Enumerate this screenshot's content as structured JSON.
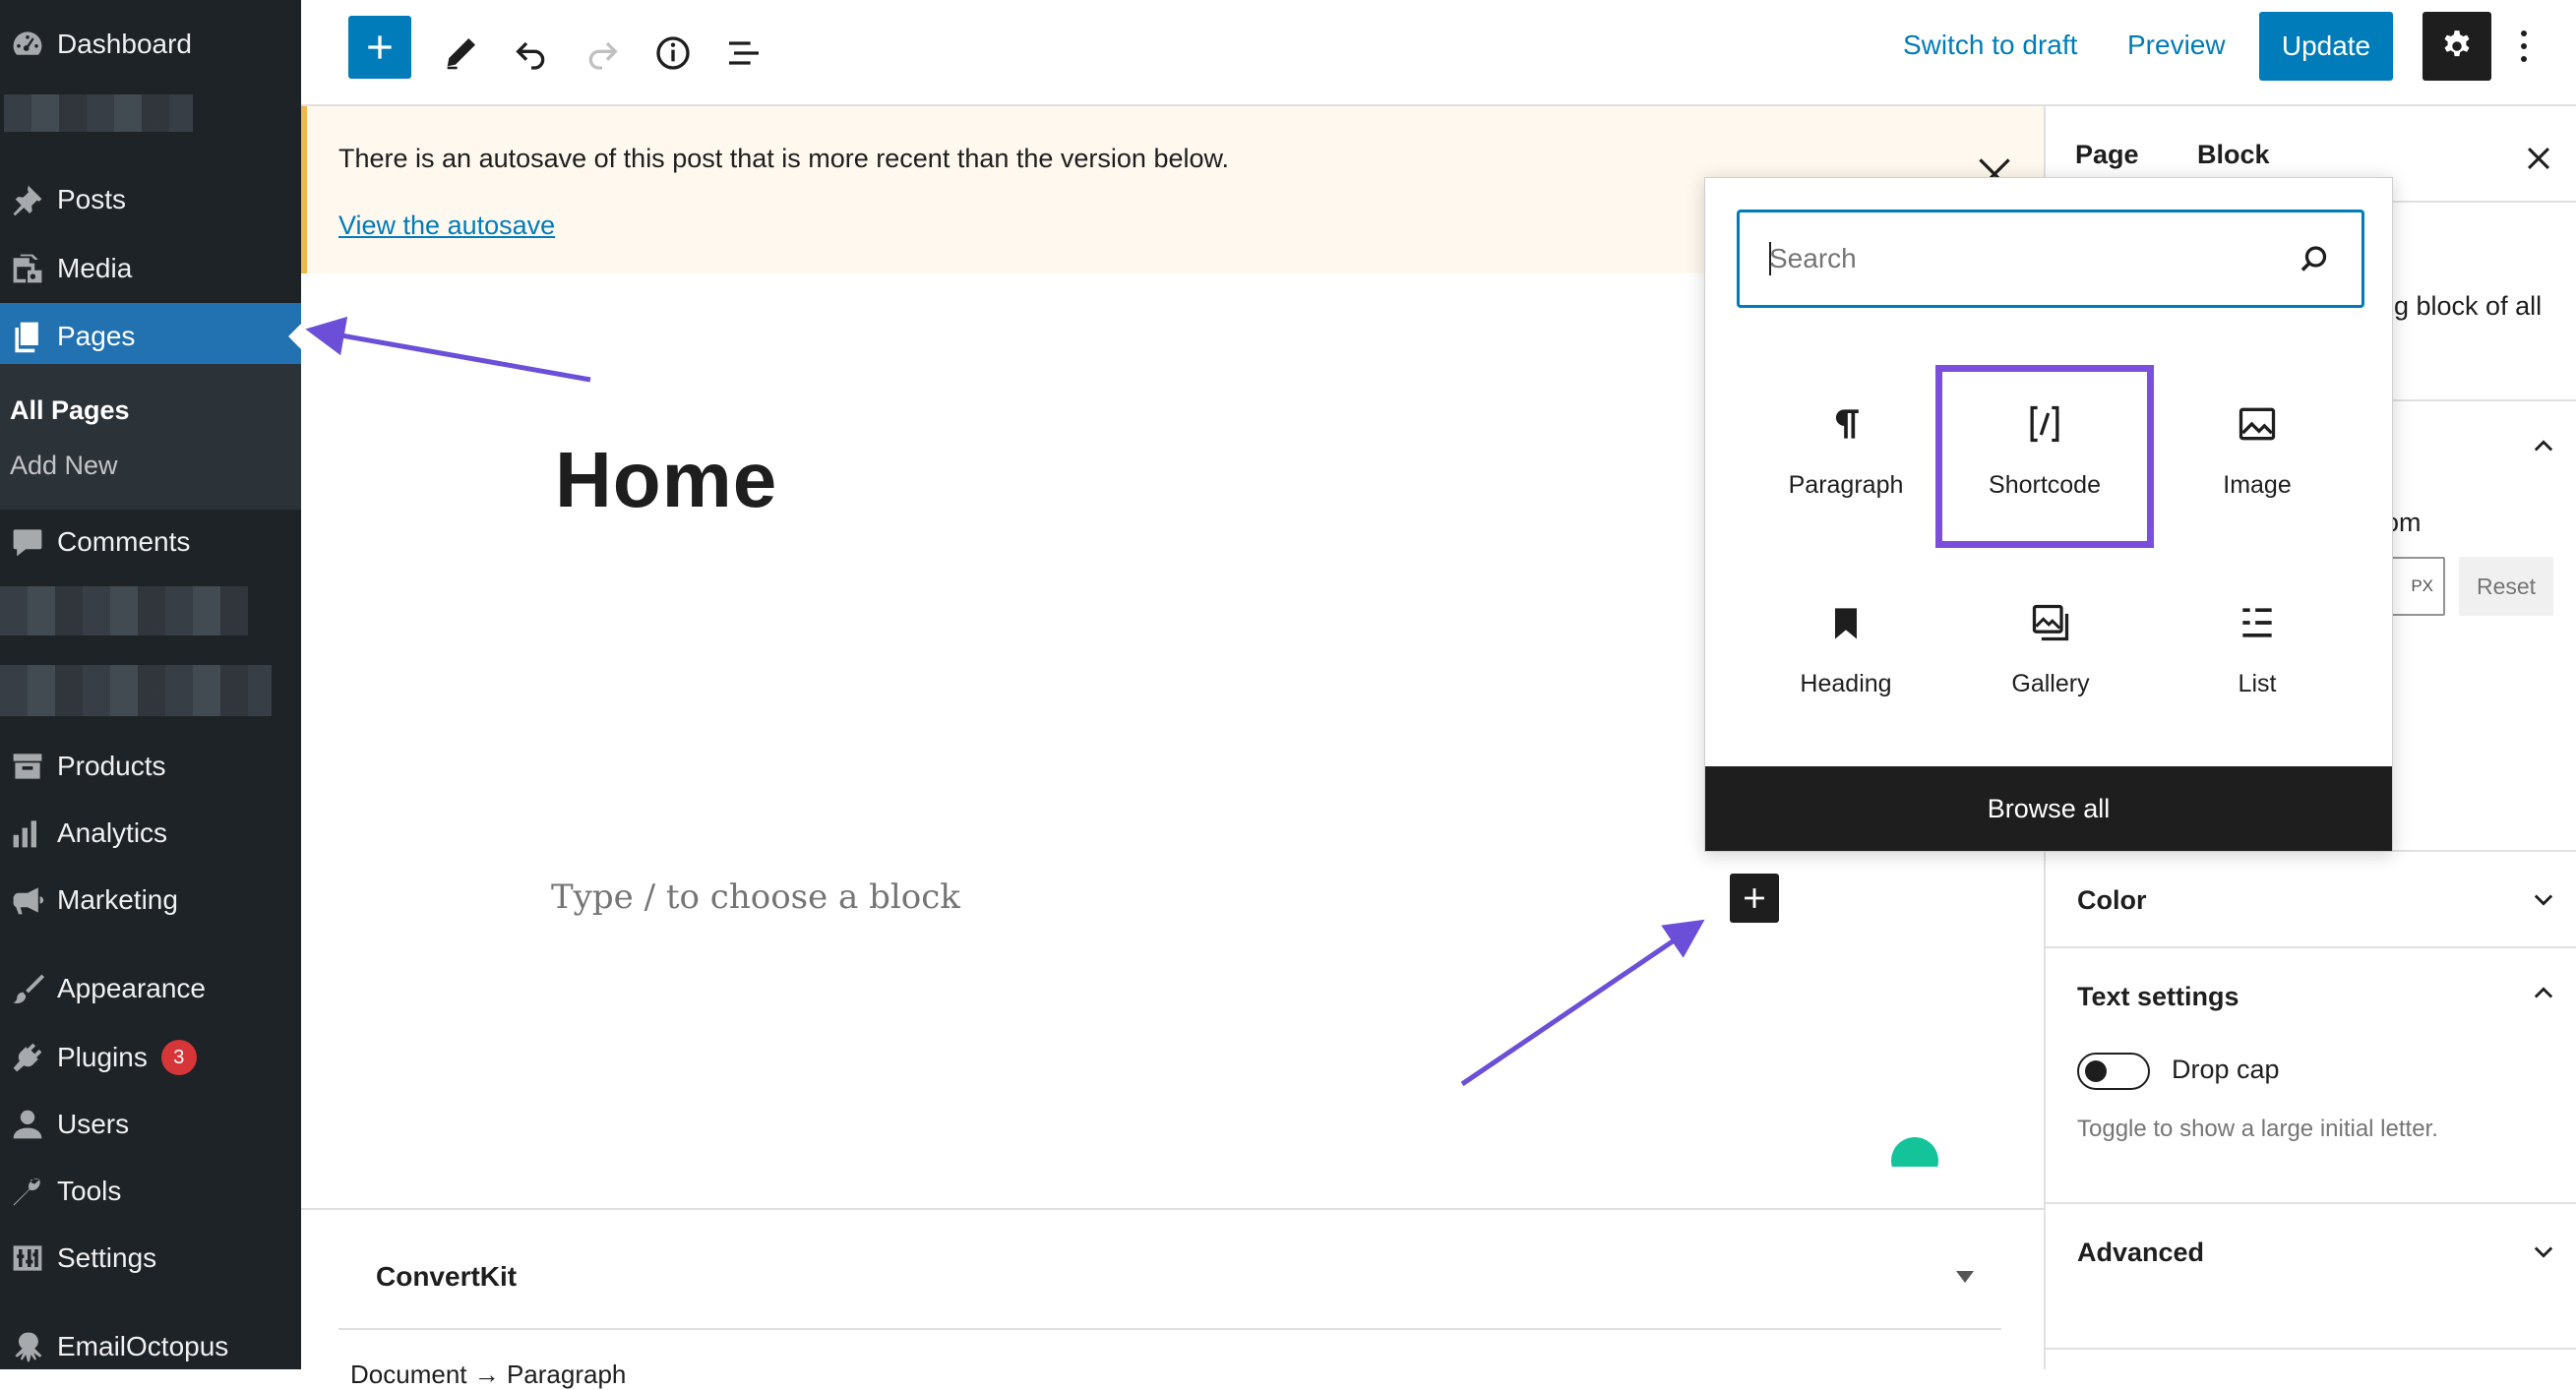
{
  "sidebar": {
    "items": [
      {
        "label": "Dashboard",
        "icon": "dashboard-icon"
      },
      {
        "label": "Posts",
        "icon": "pushpin-icon"
      },
      {
        "label": "Media",
        "icon": "media-icon"
      },
      {
        "label": "Pages",
        "icon": "pages-icon",
        "active": true
      },
      {
        "label": "Comments",
        "icon": "comment-icon"
      },
      {
        "label": "Products",
        "icon": "archive-icon"
      },
      {
        "label": "Analytics",
        "icon": "bar-chart-icon"
      },
      {
        "label": "Marketing",
        "icon": "megaphone-icon"
      },
      {
        "label": "Appearance",
        "icon": "paintbrush-icon"
      },
      {
        "label": "Plugins",
        "icon": "plugin-icon",
        "badge": "3"
      },
      {
        "label": "Users",
        "icon": "user-icon"
      },
      {
        "label": "Tools",
        "icon": "wrench-icon"
      },
      {
        "label": "Settings",
        "icon": "settings-sliders-icon"
      },
      {
        "label": "EmailOctopus",
        "icon": "octopus-icon"
      }
    ],
    "submenu": {
      "all_pages": "All Pages",
      "add_new": "Add New"
    }
  },
  "toolbar": {
    "switch_to_draft": "Switch to draft",
    "preview": "Preview",
    "update": "Update"
  },
  "notice": {
    "text": "There is an autosave of this post that is more recent than the version below.",
    "link": "View the autosave"
  },
  "editor": {
    "title": "Home",
    "placeholder": "Type / to choose a block"
  },
  "metabox": {
    "convertkit": "ConvertKit",
    "breadcrumb": "Document → Paragraph"
  },
  "panel": {
    "tabs": {
      "page": "Page",
      "block": "Block"
    },
    "desc_fragment": "g block of all",
    "typography_fragment": "om",
    "unit": "PX",
    "reset": "Reset",
    "color": "Color",
    "text_settings": "Text settings",
    "drop_cap": "Drop cap",
    "drop_cap_help": "Toggle to show a large initial letter.",
    "advanced": "Advanced"
  },
  "inserter": {
    "search_placeholder": "Search",
    "blocks": [
      {
        "label": "Paragraph",
        "icon": "pilcrow-icon"
      },
      {
        "label": "Shortcode",
        "icon": "shortcode-icon",
        "highlighted": true
      },
      {
        "label": "Image",
        "icon": "image-icon"
      },
      {
        "label": "Heading",
        "icon": "bookmark-icon"
      },
      {
        "label": "Gallery",
        "icon": "gallery-icon"
      },
      {
        "label": "List",
        "icon": "list-icon"
      }
    ],
    "browse_all": "Browse all"
  },
  "colors": {
    "sidebar_bg": "#1d2327",
    "accent": "#007cba",
    "active_menu": "#2271b1",
    "notice_bg": "#fef8ee",
    "highlight": "#7b4fdb",
    "badge": "#d63638"
  }
}
